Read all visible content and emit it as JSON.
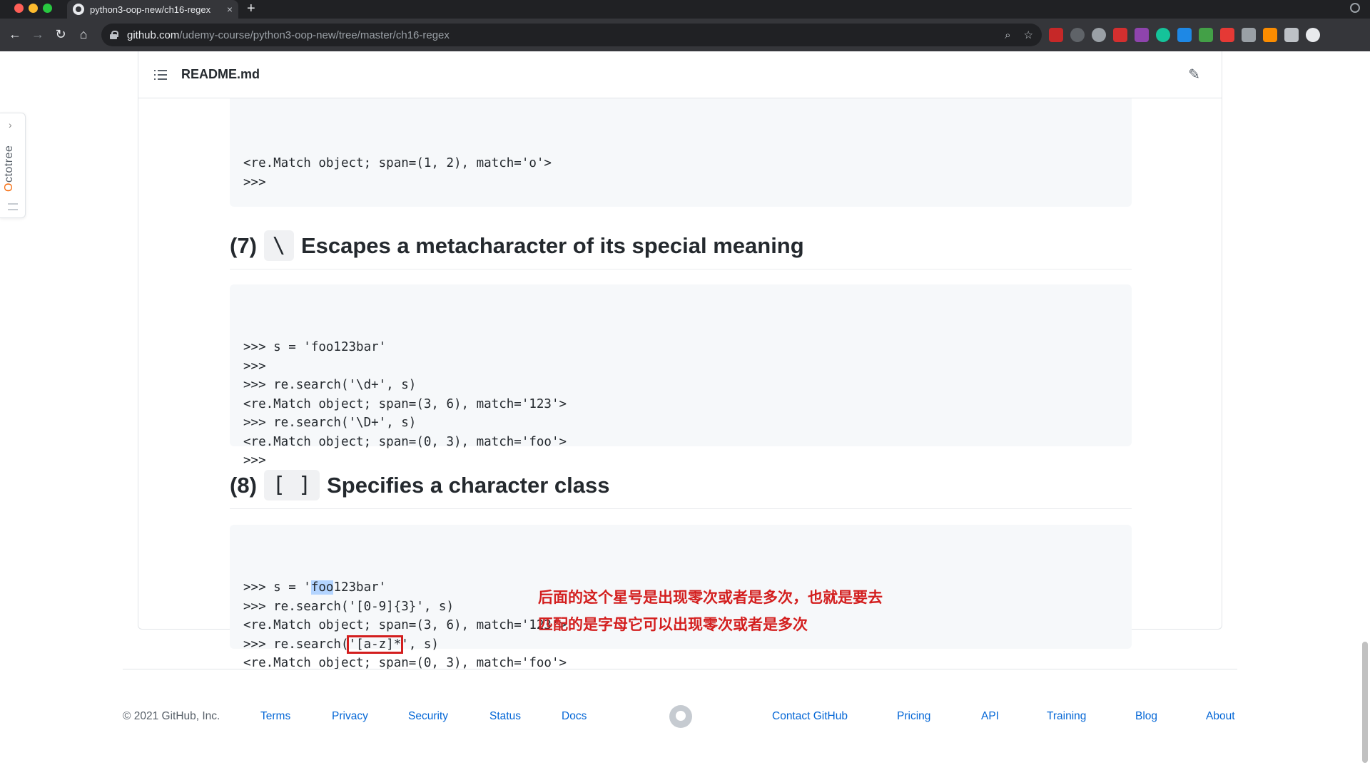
{
  "browser": {
    "tab_title": "python3-oop-new/ch16-regex",
    "tab_close": "×",
    "new_tab": "+",
    "url_host": "github.com",
    "url_path": "/udemy-course/python3-oop-new/tree/master/ch16-regex"
  },
  "octotree": {
    "label_first": "O",
    "label_rest": "ctotree"
  },
  "readme": {
    "title": "README.md",
    "top_code": [
      "<re.Match object; span=(1, 2), match='o'>",
      ">>>"
    ],
    "section7": {
      "num": "(7)",
      "symbol": "\\",
      "text": "Escapes a metacharacter of its special meaning",
      "code": [
        ">>> s = 'foo123bar'",
        ">>>",
        ">>> re.search('\\d+', s)",
        "<re.Match object; span=(3, 6), match='123'>",
        ">>> re.search('\\D+', s)",
        "<re.Match object; span=(0, 3), match='foo'>",
        ">>>"
      ]
    },
    "section8": {
      "num": "(8)",
      "symbol": "[ ]",
      "text": "Specifies a character class",
      "code_l1_a": ">>> s = '",
      "code_l1_hl": "foo",
      "code_l1_b": "123bar'",
      "code_l2": ">>> re.search('[0-9]{3}', s)",
      "code_l3": "<re.Match object; span=(3, 6), match='123'>",
      "code_l4_a": ">>> re.search(",
      "code_l4_box": "'[a-z]*",
      "code_l4_b": "', s)",
      "code_l5": "<re.Match object; span=(0, 3), match='foo'>"
    },
    "annotation_line1": "后面的这个星号是出现零次或者是多次，也就是要去",
    "annotation_line2": "匹配的是字母它可以出现零次或者是多次"
  },
  "footer": {
    "copyright": "© 2021 GitHub, Inc.",
    "links_left": [
      "Terms",
      "Privacy",
      "Security",
      "Status",
      "Docs"
    ],
    "links_right": [
      "Contact GitHub",
      "Pricing",
      "API",
      "Training",
      "Blog",
      "About"
    ]
  },
  "colors": {
    "accent_link": "#0366d6",
    "annotation_red": "#d31e1e",
    "code_bg": "#f6f8fa"
  }
}
